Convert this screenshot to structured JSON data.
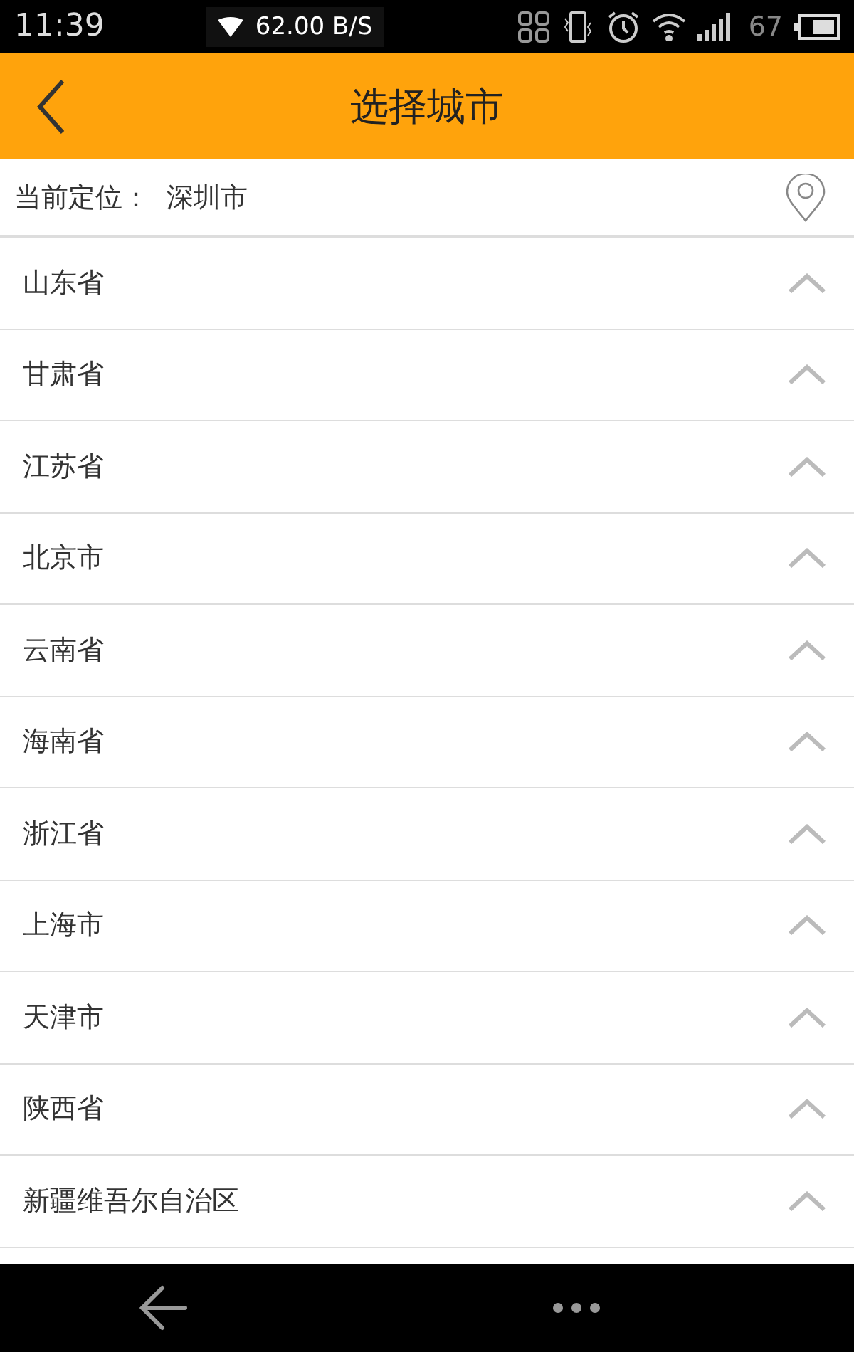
{
  "status_bar": {
    "time": "11:39",
    "speed": "62.00 B/S",
    "battery": "67"
  },
  "header": {
    "title": "选择城市"
  },
  "location": {
    "label": "当前定位：",
    "city": "深圳市"
  },
  "provinces": [
    {
      "name": "山东省"
    },
    {
      "name": "甘肃省"
    },
    {
      "name": "江苏省"
    },
    {
      "name": "北京市"
    },
    {
      "name": "云南省"
    },
    {
      "name": "海南省"
    },
    {
      "name": "浙江省"
    },
    {
      "name": "上海市"
    },
    {
      "name": "天津市"
    },
    {
      "name": "陕西省"
    },
    {
      "name": "新疆维吾尔自治区"
    }
  ]
}
